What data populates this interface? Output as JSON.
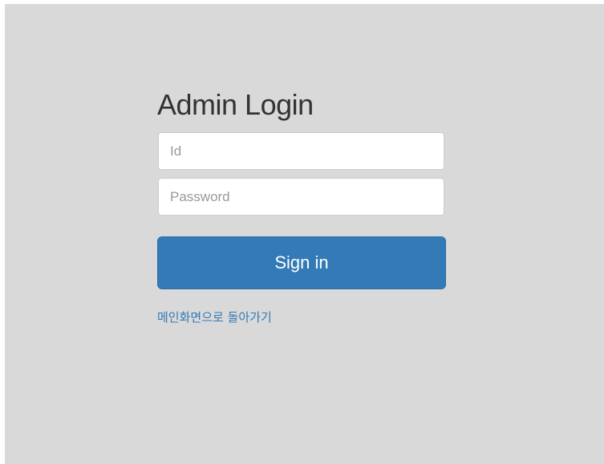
{
  "login": {
    "title": "Admin Login",
    "id_placeholder": "Id",
    "password_placeholder": "Password",
    "signin_label": "Sign in",
    "back_link_label": "메인화면으로 돌아가기"
  },
  "colors": {
    "page_background": "#d9d9d9",
    "button_primary": "#337ab7",
    "link": "#337ab7"
  }
}
